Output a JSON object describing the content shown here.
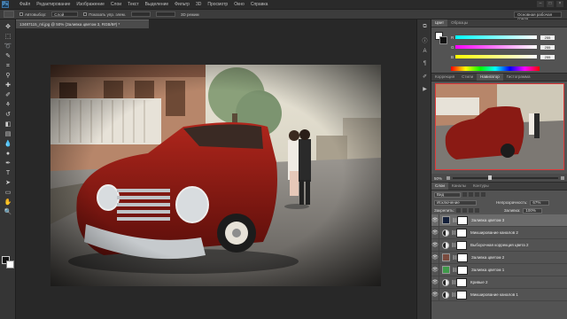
{
  "app": {
    "logo": "Ps",
    "menus": [
      "Файл",
      "Редактирование",
      "Изображение",
      "Слои",
      "Текст",
      "Выделение",
      "Фильтр",
      "3D",
      "Просмотр",
      "Окно",
      "Справка"
    ]
  },
  "options_bar": {
    "auto_select": "Автовыбор:",
    "auto_select_value": "Слой",
    "show_controls": "Показать упр. элем.",
    "mode_3d": "3D режим",
    "workspace": "Основная рабочая среда"
  },
  "document": {
    "tab_title": "13487115_ml.jpg @ 50% (Заливка цветом 3, RGB/8#) *"
  },
  "panels": {
    "color_tabs": [
      "Цвет",
      "Образцы"
    ],
    "color_sliders": [
      {
        "label": "R",
        "value": "255"
      },
      {
        "label": "G",
        "value": "255"
      },
      {
        "label": "B",
        "value": "255"
      }
    ],
    "nav_tabs": [
      "Коррекция",
      "Стили",
      "Навигатор",
      "Гистограмма"
    ],
    "nav_zoom": "50%",
    "layers_tabs": [
      "Слои",
      "Каналы",
      "Контуры"
    ],
    "filter_label": "Вид",
    "blend_mode": "Исключение",
    "opacity_label": "Непрозрачность:",
    "opacity_value": "67%",
    "lock_label": "Закрепить:",
    "fill_label": "Заливка:",
    "fill_value": "100%"
  },
  "layers": [
    {
      "name": "Заливка цветом 3",
      "type": "fill",
      "thumb_color": "#14203a",
      "selected": true
    },
    {
      "name": "Микширование каналов 2",
      "type": "adjustment",
      "selected": false
    },
    {
      "name": "Выборочная коррекция цвета 2",
      "type": "adjustment",
      "selected": false
    },
    {
      "name": "Заливка цветом 2",
      "type": "fill",
      "thumb_color": "#7a4b3e",
      "selected": false
    },
    {
      "name": "Заливка цветом 1",
      "type": "fill",
      "thumb_color": "#3f9a4a",
      "selected": false
    },
    {
      "name": "Кривые 2",
      "type": "adjustment",
      "selected": false
    },
    {
      "name": "Микширование каналов 1",
      "type": "adjustment",
      "selected": false
    }
  ],
  "colors": {
    "accent_red": "#e03a3a",
    "car_red": "#8a1a14",
    "panel_bg": "#535353"
  }
}
